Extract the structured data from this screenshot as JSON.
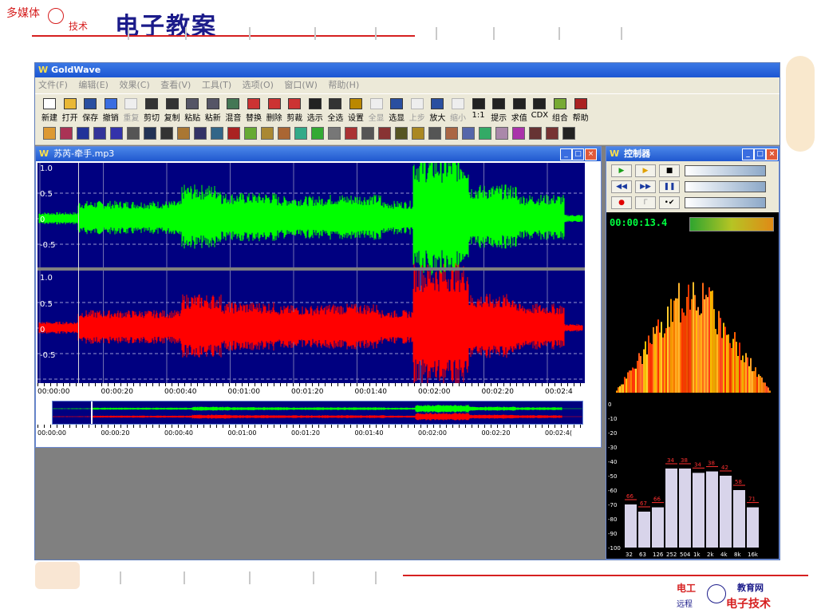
{
  "slide": {
    "brand": "多媒体",
    "brand_sub": "技术",
    "title": "电子教案",
    "footer_logo_left_top": "电工",
    "footer_logo_left_bottom": "远程",
    "footer_logo_right_top": "教育网",
    "footer_logo_right_bottom": "电子技术"
  },
  "app": {
    "title": "GoldWave",
    "menu": [
      "文件(F)",
      "编辑(E)",
      "效果(C)",
      "查看(V)",
      "工具(T)",
      "选项(O)",
      "窗口(W)",
      "帮助(H)"
    ],
    "toolbar": [
      {
        "label": "新建",
        "enabled": true
      },
      {
        "label": "打开",
        "enabled": true
      },
      {
        "label": "保存",
        "enabled": true
      },
      {
        "label": "撤销",
        "enabled": true
      },
      {
        "label": "重复",
        "enabled": false
      },
      {
        "label": "剪切",
        "enabled": true
      },
      {
        "label": "复制",
        "enabled": true
      },
      {
        "label": "粘贴",
        "enabled": true
      },
      {
        "label": "粘新",
        "enabled": true
      },
      {
        "label": "混音",
        "enabled": true
      },
      {
        "label": "替换",
        "enabled": true
      },
      {
        "label": "删除",
        "enabled": true
      },
      {
        "label": "剪裁",
        "enabled": true
      },
      {
        "label": "选示",
        "enabled": true
      },
      {
        "label": "全选",
        "enabled": true
      },
      {
        "label": "设置",
        "enabled": true
      },
      {
        "label": "全显",
        "enabled": false
      },
      {
        "label": "选显",
        "enabled": true
      },
      {
        "label": "上步",
        "enabled": false
      },
      {
        "label": "放大",
        "enabled": true
      },
      {
        "label": "缩小",
        "enabled": false
      },
      {
        "label": "1:1",
        "enabled": true
      },
      {
        "label": "提示",
        "enabled": true
      },
      {
        "label": "求值",
        "enabled": true
      },
      {
        "label": "CDX",
        "enabled": true
      },
      {
        "label": "组合",
        "enabled": true
      },
      {
        "label": "帮助",
        "enabled": true
      }
    ],
    "wave_window": {
      "title": "苏芮-牵手.mp3",
      "y_labels": [
        "1.0",
        "0.5",
        "0",
        "-0.5"
      ],
      "time_labels": [
        "00:00:00",
        "00:00:20",
        "00:00:40",
        "00:01:00",
        "00:01:20",
        "00:01:40",
        "00:02:00",
        "00:02:20",
        "00:02:4"
      ],
      "overview_labels": [
        "00:00:00",
        "00:00:20",
        "00:00:40",
        "00:01:00",
        "00:01:20",
        "00:01:40",
        "00:02:00",
        "00:02:20",
        "00:02:4("
      ],
      "colors": {
        "left": "#00ff00",
        "right": "#ff0000",
        "bg": "#000080"
      }
    },
    "controller": {
      "title": "控制器",
      "time": "00:00:13.4",
      "level_labels": [
        "0",
        "-10",
        "-20",
        "-30",
        "-40",
        "-50",
        "-60",
        "-70",
        "-80",
        "-90",
        "-100"
      ],
      "freq_labels": [
        "32",
        "63",
        "126",
        "252",
        "504",
        "1k",
        "2k",
        "4k",
        "8k",
        "16k"
      ],
      "band_values": [
        70,
        75,
        72,
        45,
        45,
        48,
        47,
        50,
        60,
        72
      ],
      "peak_labels": [
        "66",
        "67",
        "66",
        "34",
        "38",
        "34",
        "38",
        "42",
        "58",
        "71"
      ]
    }
  }
}
